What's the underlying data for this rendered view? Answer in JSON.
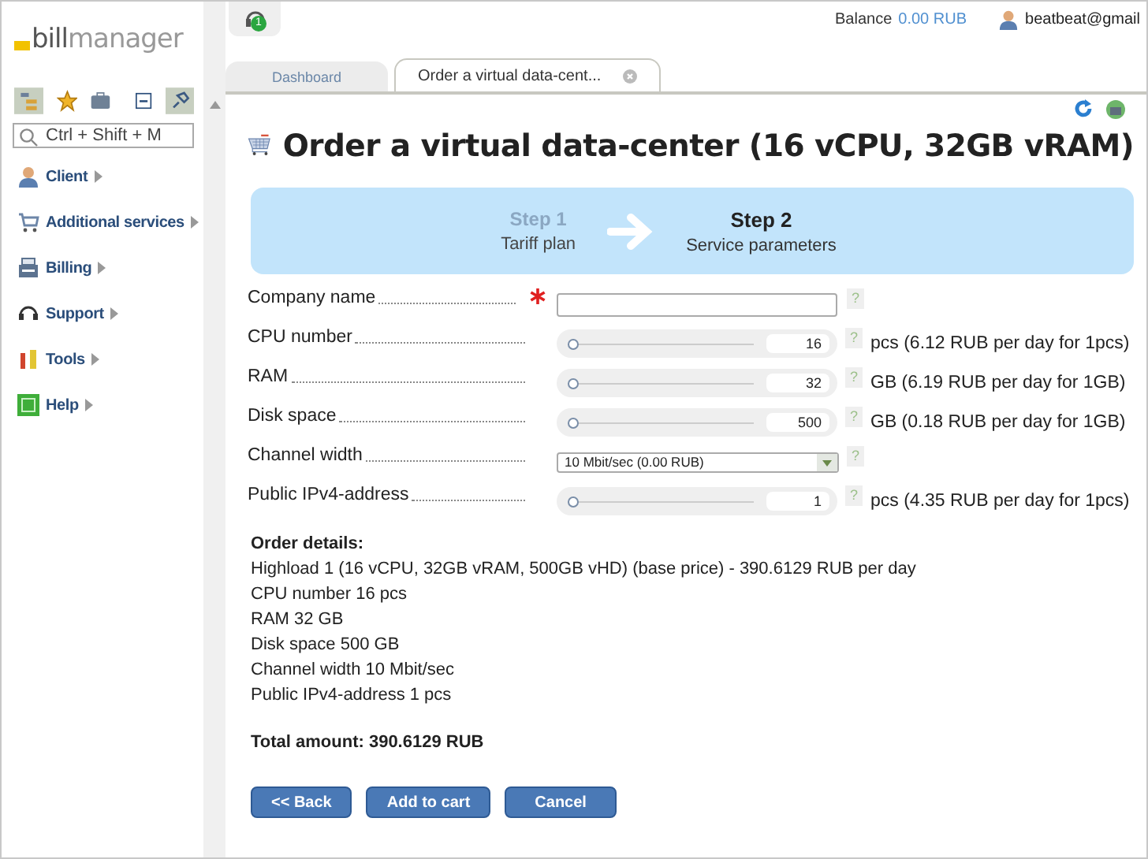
{
  "logo": {
    "part_1": "bill",
    "part_2": "manager"
  },
  "search": {
    "placeholder": "Ctrl + Shift + M"
  },
  "sidebar": {
    "items": [
      {
        "label": "Client",
        "kind": "client"
      },
      {
        "label": "Additional services",
        "kind": "cart"
      },
      {
        "label": "Billing",
        "kind": "billing"
      },
      {
        "label": "Support",
        "kind": "support"
      },
      {
        "label": "Tools",
        "kind": "tools"
      },
      {
        "label": "Help",
        "kind": "help"
      }
    ]
  },
  "top_bar": {
    "notification_count": "1",
    "balance_label": "Balance",
    "balance_value": "0.00 RUB",
    "user": "beatbeat@gmail"
  },
  "tabs": [
    {
      "label": "Dashboard",
      "selected": false,
      "closable": false
    },
    {
      "label": "Order a virtual data-cent...",
      "selected": true,
      "closable": true
    }
  ],
  "page": {
    "title": "Order a virtual data-center (16 vCPU, 32GB vRAM)",
    "steps": [
      {
        "title": "Step 1",
        "subtitle": "Tariff plan",
        "selected": false
      },
      {
        "title": "Step 2",
        "subtitle": "Service parameters",
        "selected": true
      }
    ],
    "fields": [
      {
        "kind": "text",
        "label": "Company name",
        "required": true
      },
      {
        "kind": "slider",
        "label": "CPU number",
        "required": false,
        "value": "16",
        "level": 0,
        "unit": "pcs (6.12 RUB per day for 1pcs)"
      },
      {
        "kind": "slider",
        "label": "RAM",
        "required": false,
        "value": "32",
        "level": 0,
        "unit": "GB (6.19 RUB per day for 1GB)"
      },
      {
        "kind": "slider",
        "label": "Disk space",
        "required": false,
        "value": "500",
        "level": 0,
        "unit": "GB (0.18 RUB per day for 1GB)"
      },
      {
        "kind": "select",
        "label": "Channel width",
        "required": false,
        "value": "10 Mbit/sec (0.00 RUB)"
      },
      {
        "kind": "slider",
        "label": "Public IPv4-address",
        "required": false,
        "value": "1",
        "level": 0,
        "unit": "pcs (4.35 RUB per day for 1pcs)"
      }
    ],
    "help_mark": "?",
    "details_title": "Order details:",
    "details": [
      "Highload 1 (16 vCPU, 32GB vRAM, 500GB vHD) (base price) - 390.6129 RUB per day",
      "CPU number 16 pcs",
      "RAM 32 GB",
      "Disk space 500 GB",
      "Channel width 10 Mbit/sec",
      "Public IPv4-address 1 pcs"
    ],
    "total": "Total amount: 390.6129 RUB",
    "buttons": [
      "<< Back",
      "Add to cart",
      "Cancel"
    ]
  }
}
